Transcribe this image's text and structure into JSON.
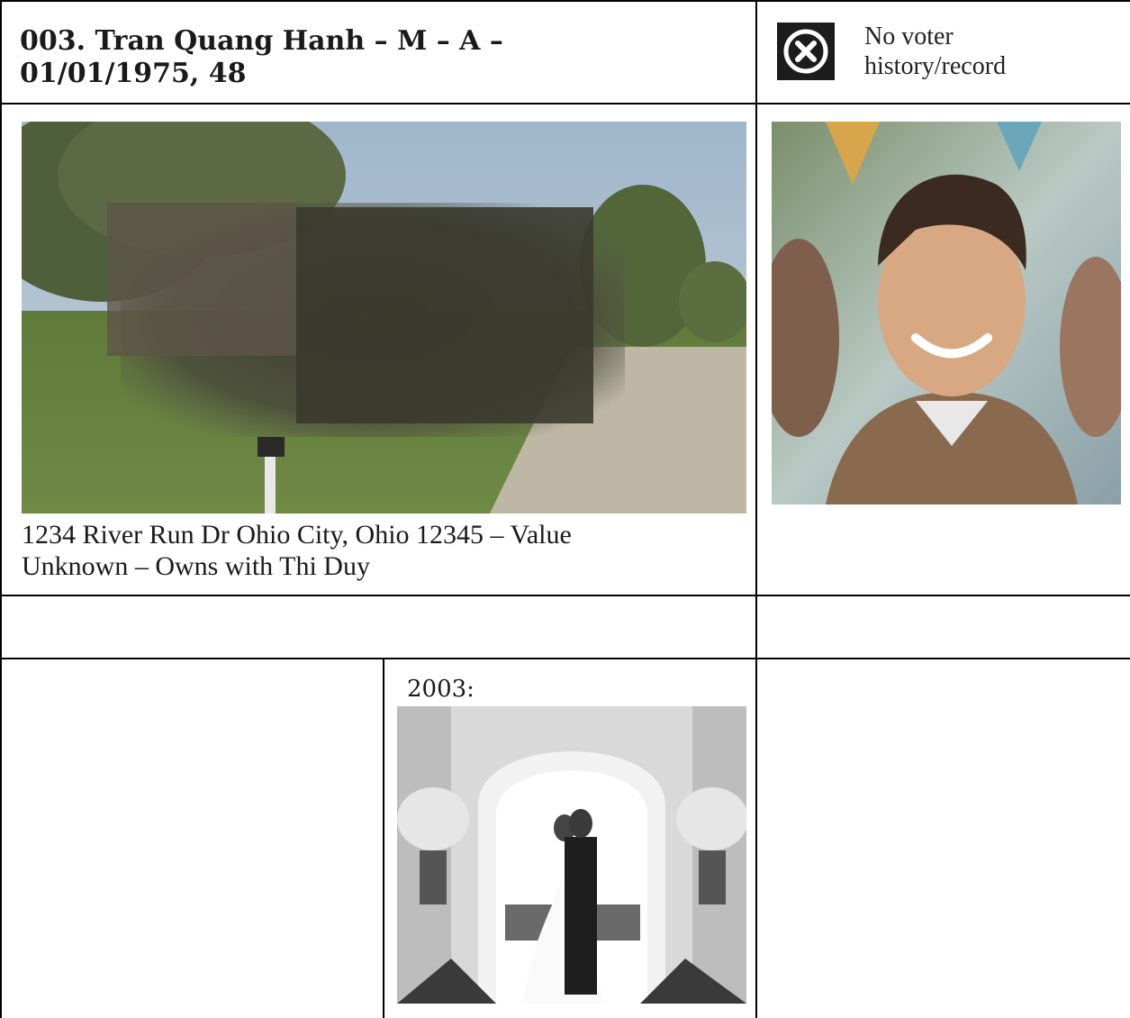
{
  "record": {
    "title_line1": "003. Tran Quang Hanh – M – A –",
    "title_line2": "01/01/1975, 48",
    "voter_status_icon": "x-circle-icon",
    "voter_status_line1": "No voter",
    "voter_status_line2": "history/record"
  },
  "property": {
    "address_line1": "1234 River Run Dr Ohio City, Ohio 12345 – Value",
    "address_line2": "Unknown – Owns with Thi Duy"
  },
  "history": {
    "year_label": "2003:"
  }
}
